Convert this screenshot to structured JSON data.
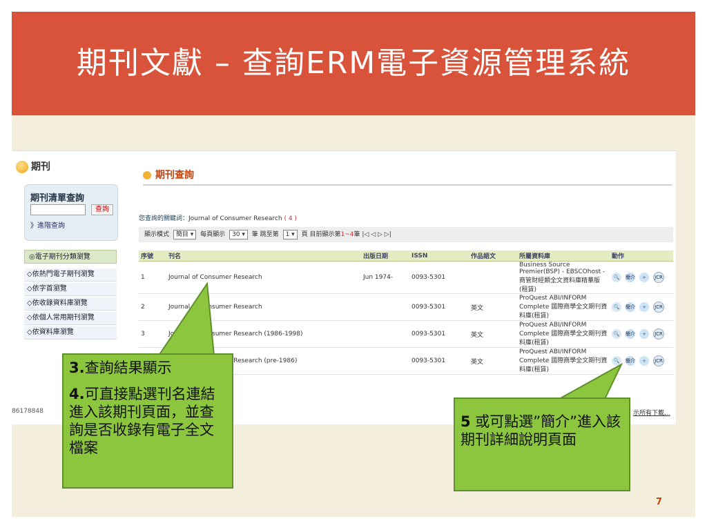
{
  "slide": {
    "title": "期刊文獻 – 查詢ERM電子資源管理系統",
    "page_number": "7",
    "colors": {
      "title_bar": "#d9533b",
      "background": "#f3efdc",
      "callout": "#8cc63f"
    }
  },
  "sidebar": {
    "logo_label": "期刊",
    "search_heading": "期刊清單查詢",
    "search_input_value": "",
    "search_button": "查詢",
    "advanced_link": "》進階查詢",
    "category_heading": "◎電子期刊分類瀏覽",
    "categories": [
      "◇依熱門電子期刊瀏覽",
      "◇依字首瀏覽",
      "◇依收錄資料庫瀏覽",
      "◇依個人常用期刊瀏覽",
      "◇依資料庫瀏覽"
    ]
  },
  "main": {
    "title": "期刊查詢",
    "keyword_label": "您查詢的關鍵詞：",
    "keyword_value": "Journal of Consumer Research",
    "keyword_count": "( 4 )",
    "toolbar": {
      "display_mode_label": "顯示模式",
      "display_mode_value": "簡目",
      "per_page_label": "每頁顯示",
      "per_page_value": "30",
      "unit": "筆",
      "jump_label": "跳至第",
      "jump_value": "1",
      "page_label": "頁",
      "current_label": "目前顯示第",
      "current_range": "1~4",
      "current_unit": "筆",
      "nav_icons": [
        "first-page-icon",
        "prev-page-icon",
        "next-page-icon",
        "last-page-icon"
      ]
    },
    "table": {
      "headers": [
        "序號",
        "刊名",
        "出版日期",
        "ISSN",
        "作品語文",
        "所屬資料庫",
        "動作"
      ],
      "rows": [
        {
          "no": "1",
          "title": "Journal of Consumer Research",
          "date": "Jun 1974-",
          "issn": "0093-5301",
          "lang": "",
          "db": "Business Source Premier(BSP) - EBSCOhost - 商管財經類全文資料庫精華版(租賃)"
        },
        {
          "no": "2",
          "title": "Journal of Consumer Research",
          "date": "",
          "issn": "0093-5301",
          "lang": "英文",
          "db": "ProQuest ABI/INFORM Complete 國際商學全文期刊資料庫(租賃)"
        },
        {
          "no": "3",
          "title": "Journal of Consumer Research (1986-1998)",
          "date": "",
          "issn": "0093-5301",
          "lang": "英文",
          "db": "ProQuest ABI/INFORM Complete 國際商學全文期刊資料庫(租賃)"
        },
        {
          "no": "4",
          "title": "Journal of Consumer Research (pre-1986)",
          "date": "",
          "issn": "0093-5301",
          "lang": "英文",
          "db": "ProQuest ABI/INFORM Complete 國際商學全文期刊資料庫(租賃)"
        }
      ],
      "action_labels": {
        "detail": "🔍",
        "intro": "簡介",
        "add": "+",
        "jcr": "JCR"
      }
    }
  },
  "status_bar": {
    "left": "86178848",
    "right": "示所有下載..."
  },
  "callouts": {
    "c3_num": "3.",
    "c3_text": "查詢結果顯示",
    "c4_num": "4.",
    "c4_text": "可直接點選刊名連結進入該期刊頁面，並查詢是否收錄有電子全文檔案",
    "c5_num": "5",
    "c5_text": " 或可點選”簡介”進入該期刊詳細說明頁面"
  }
}
